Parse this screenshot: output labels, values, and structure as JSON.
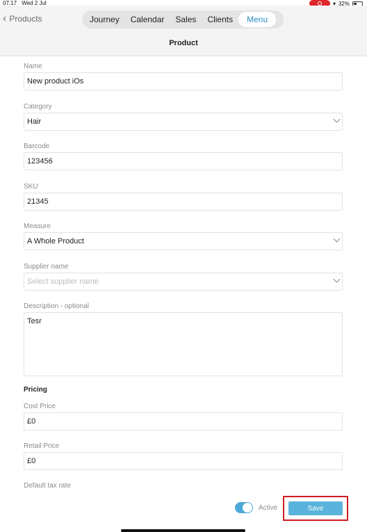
{
  "status_bar": {
    "time": "07:17",
    "date": "Wed 2 Jul",
    "battery": "32%"
  },
  "nav": {
    "back_label": "Products",
    "tabs": [
      {
        "label": "Journey"
      },
      {
        "label": "Calendar"
      },
      {
        "label": "Sales"
      },
      {
        "label": "Clients"
      },
      {
        "label": "Menu"
      }
    ],
    "active_tab": "Menu"
  },
  "page": {
    "title": "Product"
  },
  "form": {
    "name": {
      "label": "Name",
      "value": "New product iOs"
    },
    "category": {
      "label": "Category",
      "value": "Hair"
    },
    "barcode": {
      "label": "Barcode",
      "value": "123456"
    },
    "sku": {
      "label": "SKU",
      "value": "21345"
    },
    "measure": {
      "label": "Measure",
      "value": "A Whole Product"
    },
    "supplier": {
      "label": "Supplier name",
      "placeholder": "Select supplier name"
    },
    "description": {
      "label": "Description - optional",
      "value": "Tesr"
    },
    "pricing_heading": "Pricing",
    "cost_price": {
      "label": "Cost Price",
      "value": "£0"
    },
    "retail_price": {
      "label": "Retail Price",
      "value": "£0"
    },
    "tax_rate": {
      "label": "Default tax rate"
    }
  },
  "footer": {
    "active_label": "Active",
    "active_on": true,
    "save_label": "Save"
  },
  "colors": {
    "accent": "#2d8ec8",
    "button": "#5ab3db",
    "highlight": "#d11a1f"
  }
}
